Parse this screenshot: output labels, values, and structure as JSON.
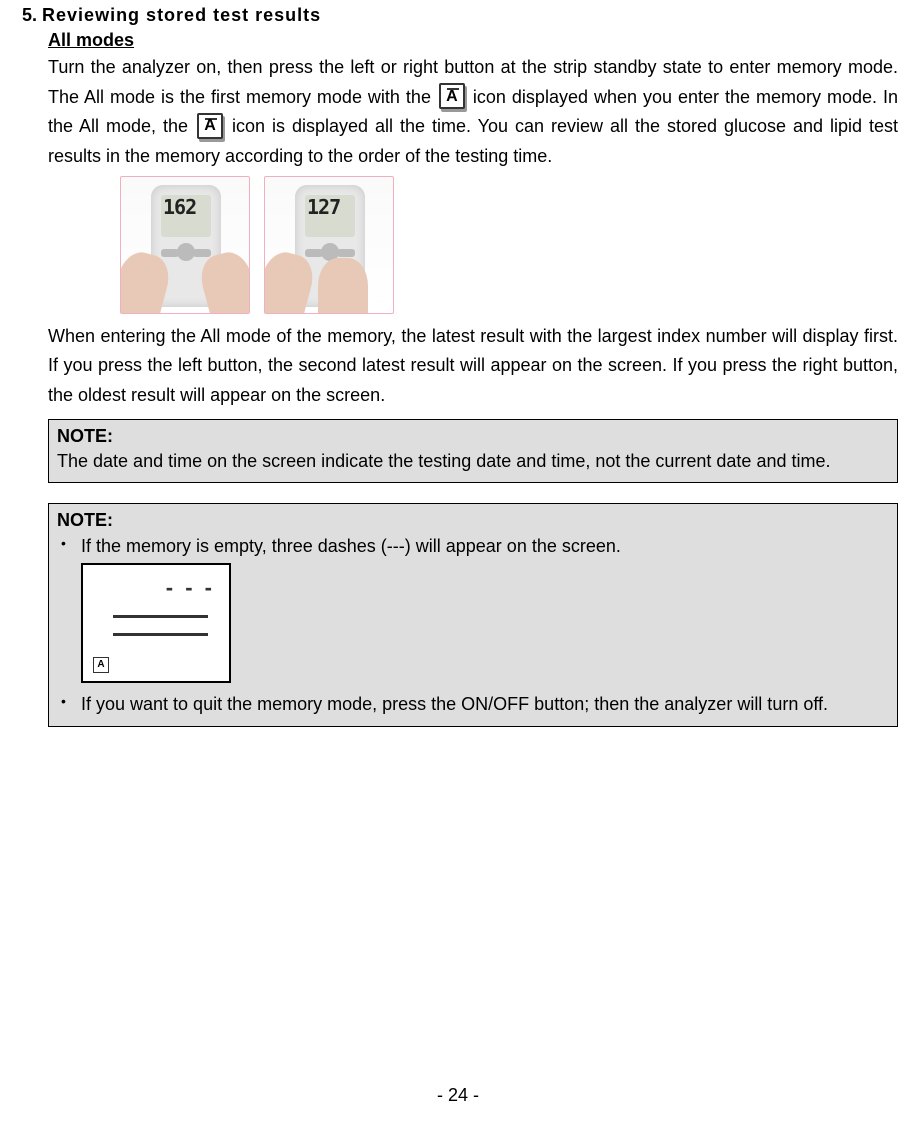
{
  "section": {
    "number": "5.",
    "title": "Reviewing stored test results"
  },
  "subheading": "All modes",
  "p1a": "Turn the analyzer on, then press the left or right button at the strip standby state to enter memory mode. The All mode is the first memory mode with the ",
  "p1b": " icon displayed when you enter the memory mode. In the All mode, the ",
  "p1c": " icon is displayed all the time. You can review all the stored glucose and lipid test results in the memory according to the order of the testing time.",
  "device1_value": "162",
  "device2_value": "127",
  "p2": "When entering the All mode of the memory, the latest result with the largest index number will display first. If you press the left button, the second latest result will appear on the screen. If you press the right button, the oldest result will appear on the screen.",
  "note1": {
    "label": "NOTE:",
    "text": "The date and time on the screen indicate the testing date and time, not the current date and time."
  },
  "note2": {
    "label": "NOTE:",
    "item1": "If the memory is empty, three dashes (---) will appear on the screen.",
    "item2": "If you want to quit the memory mode, press the ON/OFF button; then the analyzer will turn off."
  },
  "empty_screen": {
    "dashes": "- - -",
    "icon_letter": "A"
  },
  "icon_letter": "A",
  "page_number": "- 24 -"
}
